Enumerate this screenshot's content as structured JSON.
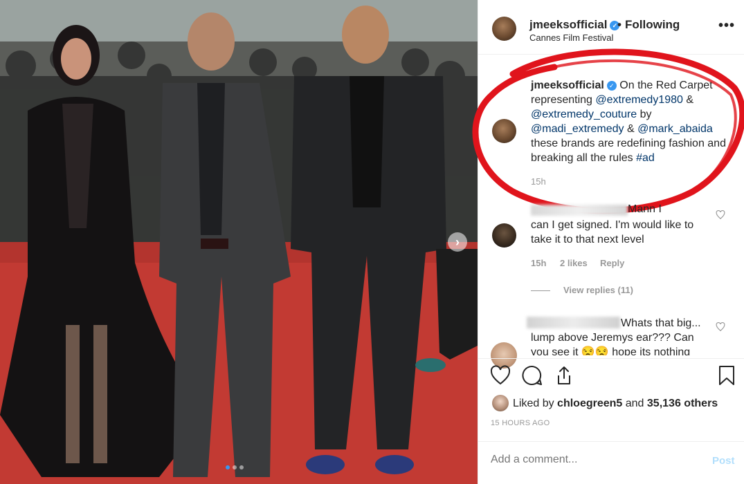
{
  "post": {
    "author": "jmeeksofficial",
    "follow_status": "Following",
    "location": "Cannes Film Festival",
    "more_icon": "more-horizontal-icon"
  },
  "caption": {
    "author": "jmeeksofficial",
    "part1": " On the Red Carpet representing ",
    "mention1": "@extremedy1980",
    "part2": " & ",
    "mention2": "@extremedy_couture",
    "part3": " by ",
    "mention3": "@madi_extremedy",
    "part4": " & ",
    "mention4": "@mark_abaida",
    "part5": " these brands are redefining fashion and breaking all the rules ",
    "hashtag": "#ad",
    "time": "15h"
  },
  "comments": [
    {
      "visible_start": "Mann I",
      "text": "can I get signed. I'm would like to take it to that next level",
      "time": "15h",
      "likes": "2 likes",
      "reply": "Reply",
      "view_replies": "View replies (11)"
    },
    {
      "text": "Whats that big... lump above Jeremys ear??? Can you see it 😒😒 hope its nothing"
    }
  ],
  "likes": {
    "prefix": "Liked by ",
    "user": "chloegreen5",
    "middle": " and ",
    "count": "35,136 others"
  },
  "timestamp": "15 HOURS AGO",
  "comment_box": {
    "placeholder": "Add a comment...",
    "post_label": "Post"
  },
  "colors": {
    "accent": "#3897f0",
    "annotation": "#e0141c",
    "carpet": "#c23a33"
  }
}
